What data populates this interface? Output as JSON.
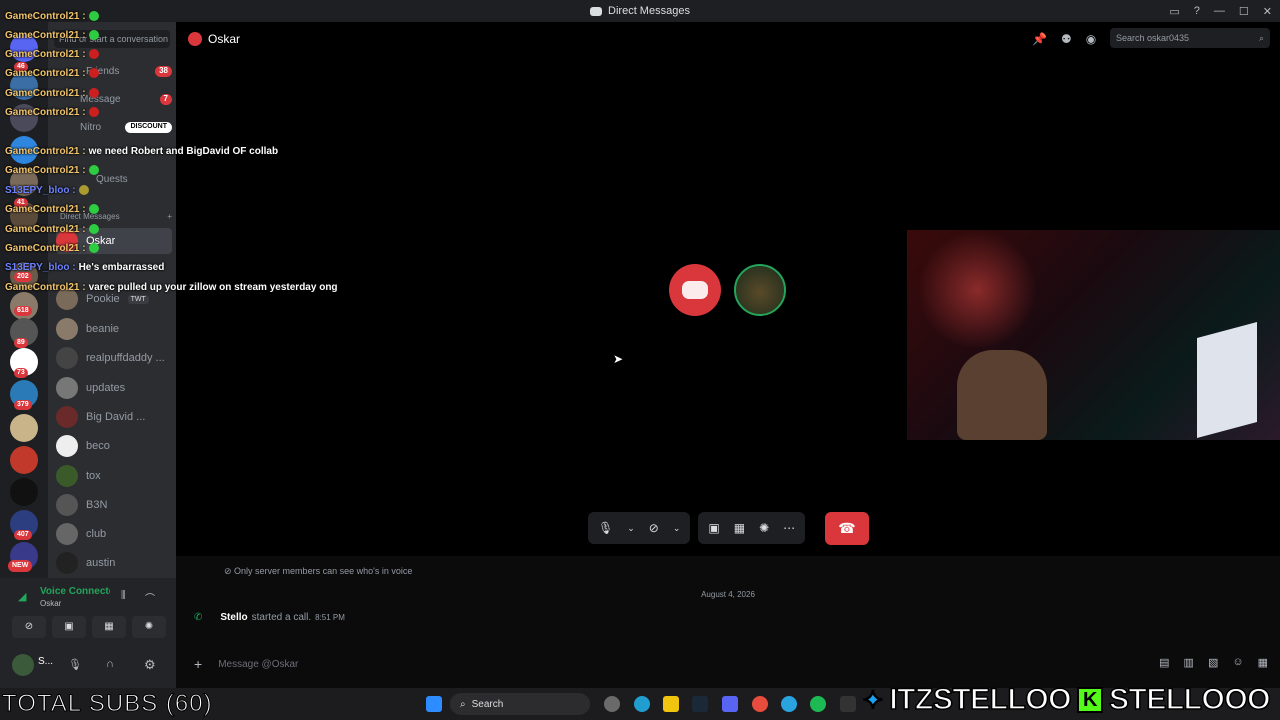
{
  "window": {
    "title": "Direct Messages"
  },
  "sidebar": {
    "find_placeholder": "Find or start a conversation",
    "nav": [
      {
        "label": "Friends",
        "badge": "38"
      },
      {
        "label": "Message Requests",
        "badge": "7"
      },
      {
        "label": "Nitro",
        "badge": "DISCOUNT"
      },
      {
        "label": "Quests"
      }
    ],
    "dm_header": "Direct Messages",
    "dms": [
      "Oskar",
      "Pookie",
      "beanie",
      "realpuffdaddy ...",
      "updates",
      "Big David ...",
      "beco",
      "tox",
      "B3N",
      "club",
      "austin"
    ],
    "pookie_tag": "TWT"
  },
  "guild_badges": [
    "46",
    "41",
    "618",
    "89",
    "73",
    "379",
    "202",
    "407",
    "NEW"
  ],
  "voice": {
    "status": "Voice Connected",
    "channel": "Oskar"
  },
  "user": {
    "name": "S..."
  },
  "header": {
    "title": "Oskar",
    "search_placeholder": "Search oskar0435"
  },
  "chat": {
    "privacy_note": "Only server members can see who's in voice",
    "date_divider": "August 4, 2026",
    "call_user": "Stello",
    "call_text": "started a call.",
    "call_time": "8:51 PM",
    "input_placeholder": "Message @Oskar"
  },
  "taskbar": {
    "search": "Search"
  },
  "overlay": {
    "lines": [
      {
        "name": "GameControl21 :",
        "msg": "",
        "blue": false
      },
      {
        "name": "GameControl21 :",
        "msg": "",
        "blue": false
      },
      {
        "name": "GameControl21 :",
        "msg": "",
        "blue": false
      },
      {
        "name": "GameControl21 :",
        "msg": "",
        "blue": false
      },
      {
        "name": "GameControl21 :",
        "msg": "",
        "blue": false
      },
      {
        "name": "GameControl21 :",
        "msg": "",
        "blue": false
      },
      {
        "name": "GameControl21 :",
        "msg": "we need Robert and BigDavid OF collab",
        "blue": false
      },
      {
        "name": "GameControl21 :",
        "msg": "",
        "blue": false
      },
      {
        "name": "S13EPY_bloo :",
        "msg": "",
        "blue": true
      },
      {
        "name": "GameControl21 :",
        "msg": "",
        "blue": false
      },
      {
        "name": "GameControl21 :",
        "msg": "",
        "blue": false
      },
      {
        "name": "GameControl21 :",
        "msg": "",
        "blue": false
      },
      {
        "name": "S13EPY_bloo :",
        "msg": "He's embarrassed",
        "blue": true
      },
      {
        "name": "GameControl21 :",
        "msg": "varec pulled up your zillow on stream yesterday ong",
        "blue": false
      }
    ],
    "total_subs": "TOTAL SUBS (60)",
    "twitter_handle": "ITZSTELLOO",
    "kick_handle": "STELLOOO"
  },
  "colors": {
    "accent": "#5865f2",
    "danger": "#da373c",
    "bg": "#000000",
    "sidebar": "#2b2d31"
  }
}
